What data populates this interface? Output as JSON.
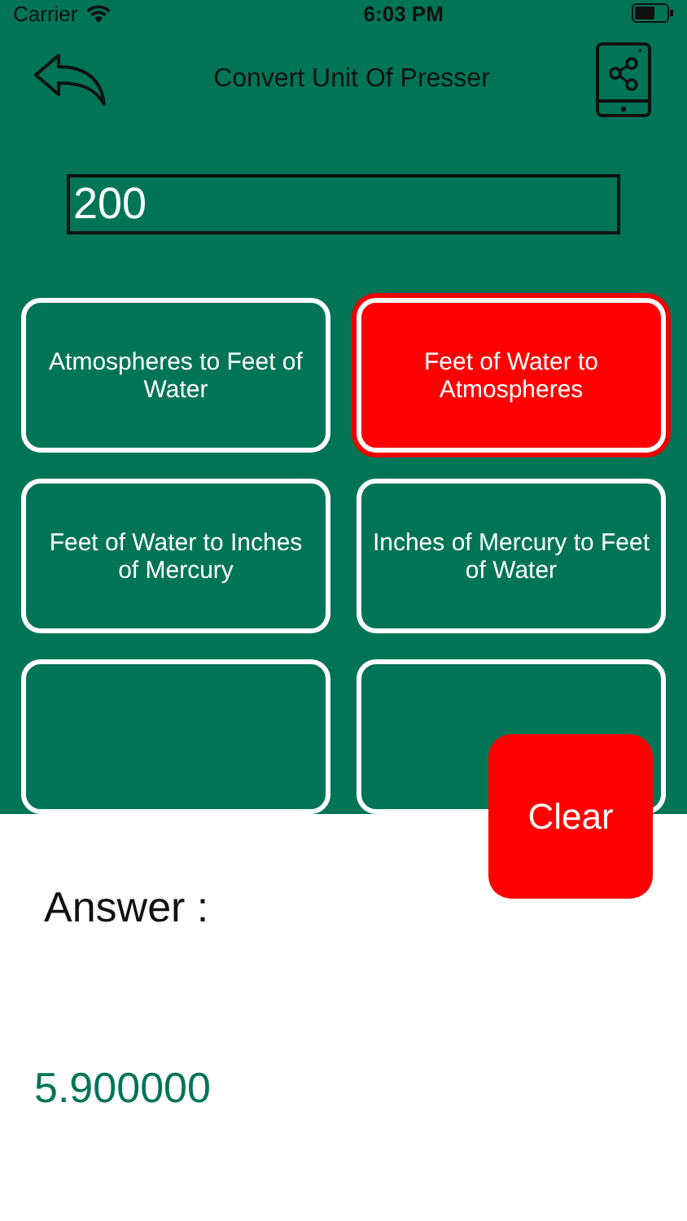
{
  "status_bar": {
    "carrier": "Carrier",
    "time": "6:03 PM"
  },
  "header": {
    "title": "Convert Unit Of Presser"
  },
  "input": {
    "value": "200"
  },
  "conversions": [
    {
      "label": "Atmospheres to Feet of Water",
      "selected": false
    },
    {
      "label": "Feet of Water to Atmospheres",
      "selected": true
    },
    {
      "label": "Feet of Water to Inches of Mercury",
      "selected": false
    },
    {
      "label": "Inches of Mercury to Feet of Water",
      "selected": false
    },
    {
      "selected": false
    },
    {
      "selected": false
    }
  ],
  "clear_button": {
    "label": "Clear"
  },
  "answer": {
    "label": "Answer :",
    "value": "5.900000"
  }
}
